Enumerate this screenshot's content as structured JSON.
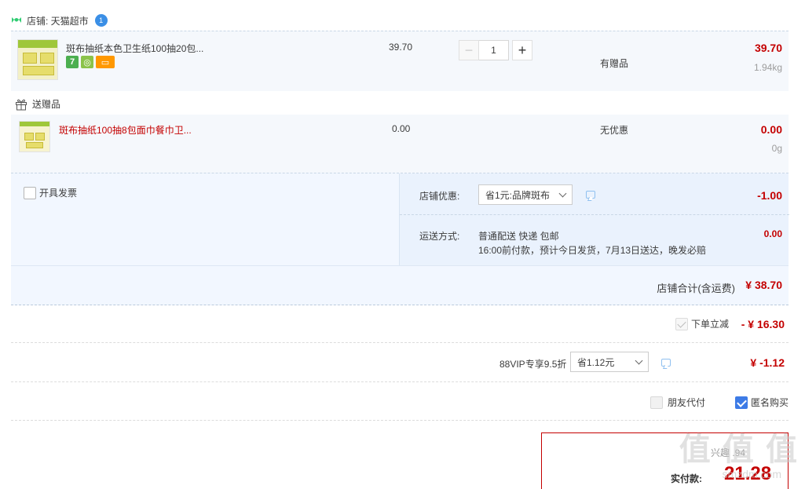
{
  "shop": {
    "label": "店铺: 天猫超市",
    "ww_badge": "1"
  },
  "item": {
    "title": "斑布抽纸本色卫生纸100抽20包...",
    "unit_price": "39.70",
    "quantity": "1",
    "promo": "有赠品",
    "total": "39.70",
    "weight": "1.94kg",
    "badges": [
      {
        "text": "7",
        "color": "#4caf50"
      },
      {
        "text": "◎",
        "color": "#8bc34a"
      },
      {
        "text": "▭",
        "color": "#ff9800"
      }
    ]
  },
  "gift": {
    "header": "送赠品",
    "title": "斑布抽纸100抽8包面巾餐巾卫...",
    "unit_price": "0.00",
    "promo": "无优惠",
    "total": "0.00",
    "weight": "0g"
  },
  "invoice": {
    "label": "开具发票"
  },
  "shop_discount": {
    "label": "店铺优惠:",
    "selected": "省1元:品牌斑布",
    "amount": "-1.00"
  },
  "shipping": {
    "label": "运送方式:",
    "method": "普通配送 快递 包邮",
    "detail": "16:00前付款，预计今日发货，7月13日送达，晚发必赔",
    "amount": "0.00"
  },
  "shop_total": {
    "label": "店铺合计(含运费)",
    "amount": "¥ 38.70"
  },
  "instant_discount": {
    "label": "下单立减",
    "amount": "- ¥ 16.30"
  },
  "vip": {
    "label": "88VIP专享9.5折",
    "selected": "省1.12元",
    "amount": "¥ -1.12"
  },
  "friend_pay": {
    "label": "朋友代付"
  },
  "anonymous": {
    "label": "匿名购买"
  },
  "payment": {
    "points_label": "兴趣  .94",
    "label": "实付款:",
    "amount": "21.28"
  },
  "watermark": {
    "text": "值 值 值",
    "sub": "smzdm.com"
  }
}
